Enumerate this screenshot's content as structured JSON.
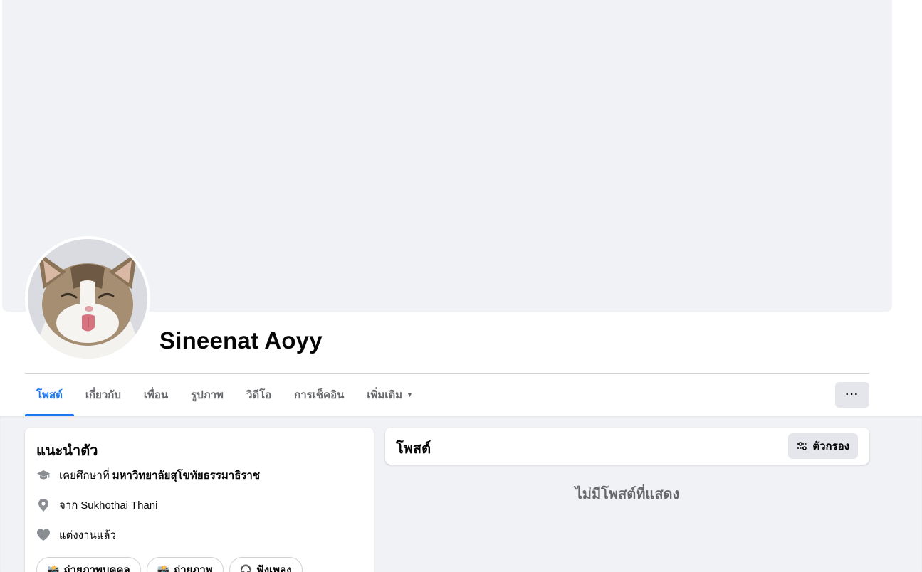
{
  "profile": {
    "name": "Sineenat Aoyy"
  },
  "tabs": [
    {
      "label": "โพสต์"
    },
    {
      "label": "เกี่ยวกับ"
    },
    {
      "label": "เพื่อน"
    },
    {
      "label": "รูปภาพ"
    },
    {
      "label": "วิดีโอ"
    },
    {
      "label": "การเช็คอิน"
    },
    {
      "label": "เพิ่มเติม"
    }
  ],
  "more_options_label": "···",
  "intro": {
    "title": "แนะนำตัว",
    "education_prefix": "เคยศึกษาที่",
    "education_school": "มหาวิทยาลัยสุโขทัยธรรมาธิราช",
    "from_prefix": "จาก",
    "from_place": "Sukhothai Thani",
    "relationship": "แต่งงานแล้ว",
    "chips": [
      {
        "emoji": "📸",
        "label": "ถ่ายภาพบุคคล"
      },
      {
        "emoji": "📸",
        "label": "ถ่ายภาพ"
      },
      {
        "emoji": "🎧",
        "label": "ฟังเพลง"
      }
    ]
  },
  "posts": {
    "title": "โพสต์",
    "filter_label": "ตัวกรอง",
    "empty_message": "ไม่มีโพสต์ที่แสดง"
  },
  "colors": {
    "accent": "#1877f2",
    "page_bg": "#f0f2f5",
    "secondary_text": "#65676b"
  }
}
